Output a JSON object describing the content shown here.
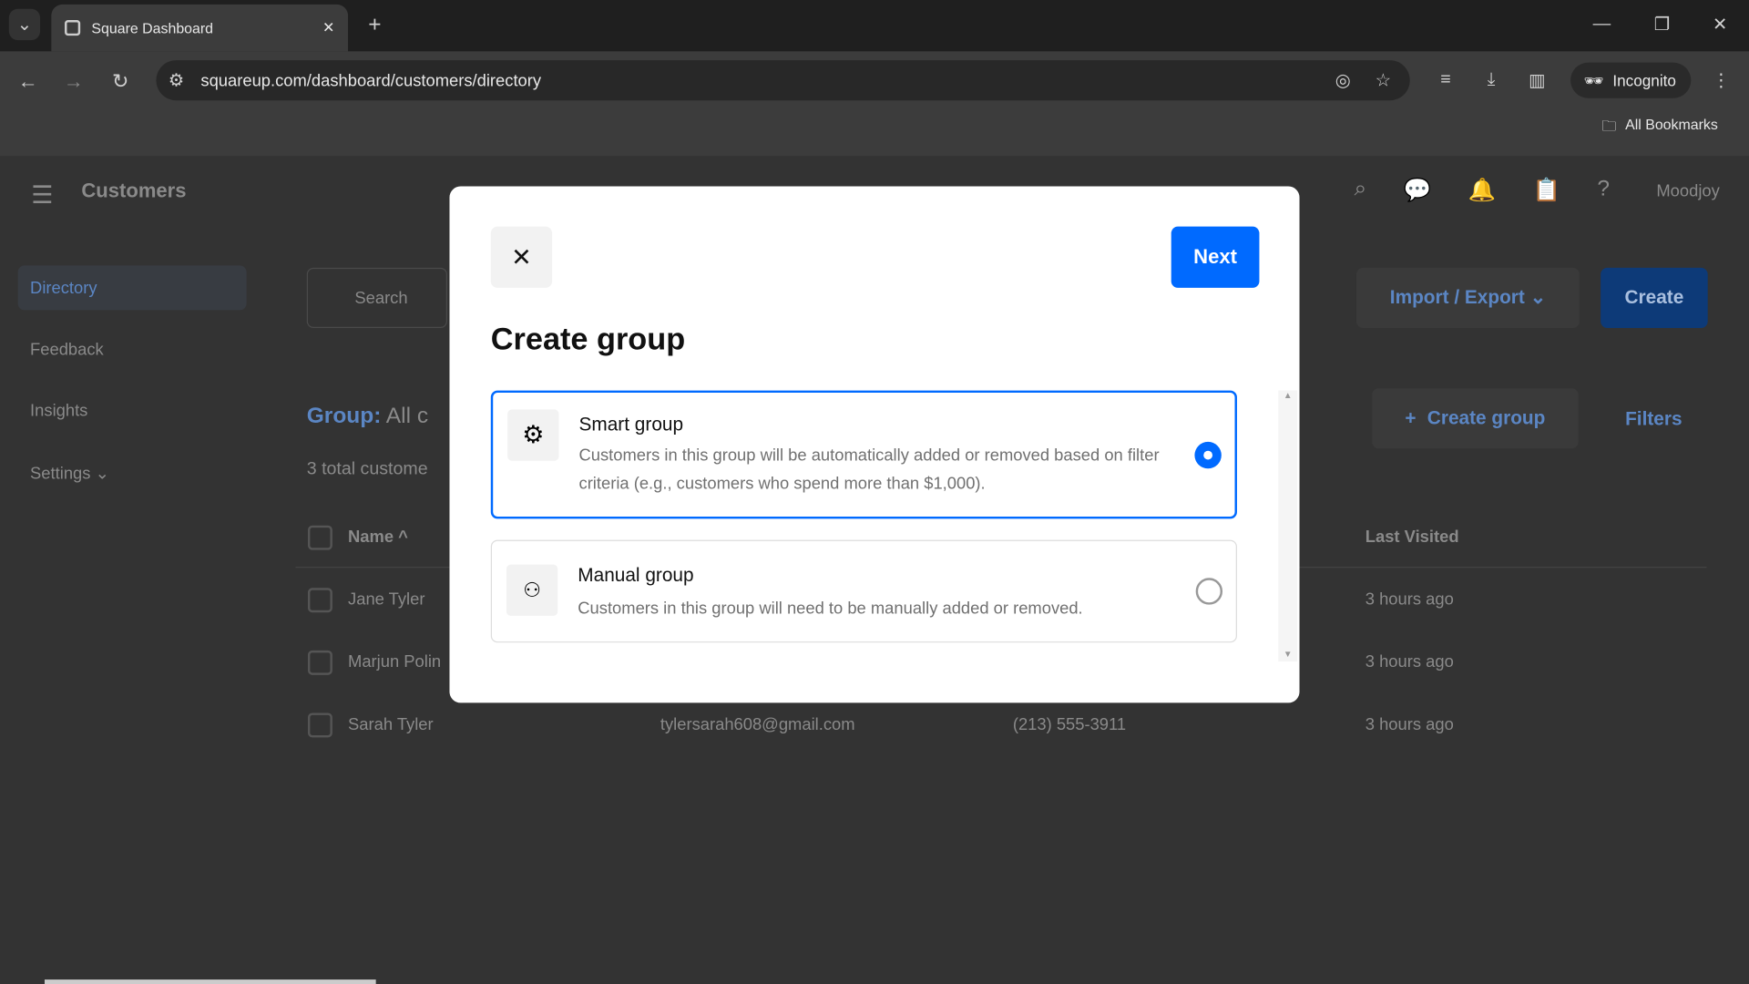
{
  "browser": {
    "tab_title": "Square Dashboard",
    "url": "squareup.com/dashboard/customers/directory",
    "incognito_label": "Incognito",
    "bookmarks_label": "All Bookmarks"
  },
  "app": {
    "title": "Customers",
    "user": "Moodjoy",
    "sidebar": [
      {
        "label": "Directory",
        "active": true
      },
      {
        "label": "Feedback"
      },
      {
        "label": "Insights"
      },
      {
        "label": "Settings"
      }
    ],
    "search_placeholder": "Search",
    "import_export": "Import / Export",
    "create": "Create",
    "group_label": "Group:",
    "group_value": "All c",
    "total": "3 total custome",
    "create_group": "Create group",
    "filters": "Filters",
    "columns": {
      "name": "Name",
      "last_visited": "Last Visited"
    },
    "rows": [
      {
        "name": "Jane Tyler",
        "email": "",
        "phone": "",
        "last": "3 hours ago"
      },
      {
        "name": "Marjun Polin",
        "email": "",
        "phone": "",
        "last": "3 hours ago"
      },
      {
        "name": "Sarah Tyler",
        "email": "tylersarah608@gmail.com",
        "phone": "(213) 555-3911",
        "last": "3 hours ago"
      }
    ]
  },
  "modal": {
    "title": "Create group",
    "next": "Next",
    "options": [
      {
        "title": "Smart group",
        "desc": "Customers in this group will be automatically added or removed based on filter criteria (e.g., customers who spend more than $1,000).",
        "selected": true,
        "icon": "gear-icon"
      },
      {
        "title": "Manual group",
        "desc": "Customers in this group will need to be manually added or removed.",
        "selected": false,
        "icon": "people-icon"
      }
    ]
  },
  "colors": {
    "accent": "#006aff"
  }
}
